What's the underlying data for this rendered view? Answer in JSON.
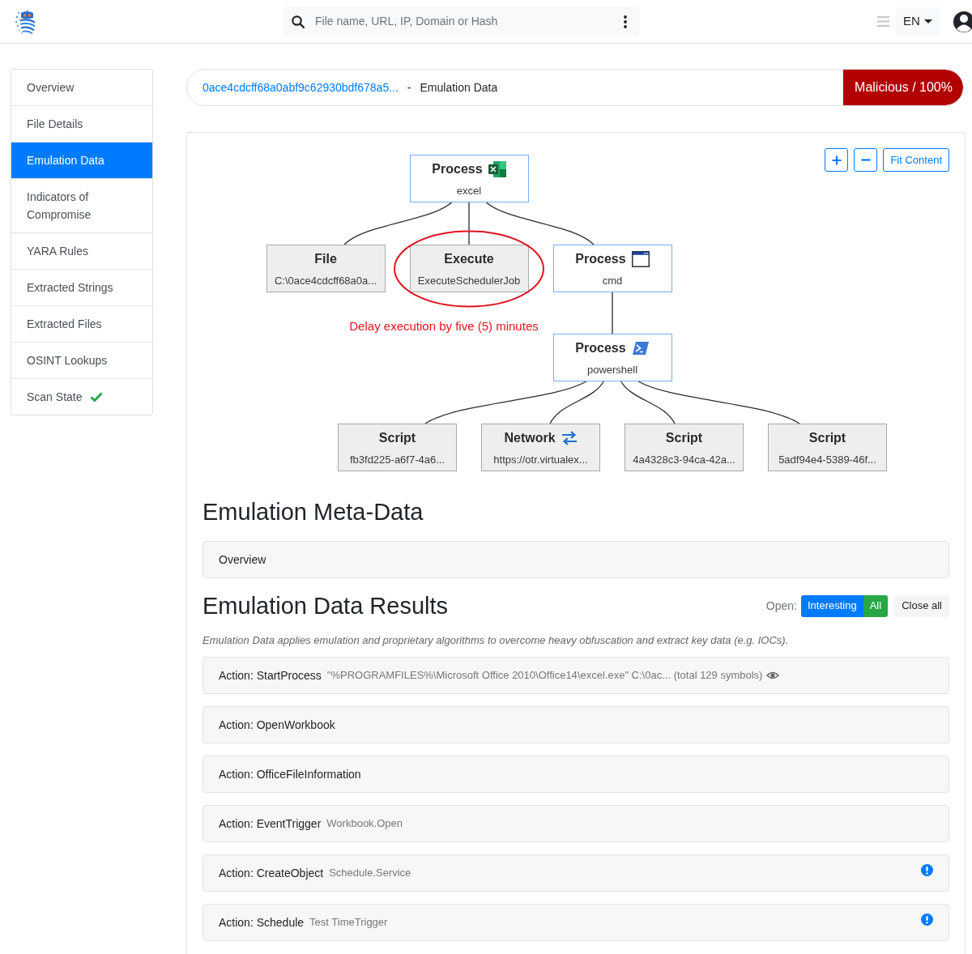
{
  "header": {
    "search": {
      "placeholder": "File name, URL, IP, Domain or Hash"
    },
    "language": "EN"
  },
  "sidebar": {
    "items": [
      {
        "label": "Overview",
        "selected": false,
        "kind": "link"
      },
      {
        "label": "File Details",
        "selected": false,
        "kind": "link"
      },
      {
        "label": "Emulation Data",
        "selected": true,
        "kind": "link"
      },
      {
        "label": "Indicators of Compromise",
        "selected": false,
        "kind": "link"
      },
      {
        "label": "YARA Rules",
        "selected": false,
        "kind": "link"
      },
      {
        "label": "Extracted Strings",
        "selected": false,
        "kind": "link"
      },
      {
        "label": "Extracted Files",
        "selected": false,
        "kind": "link"
      },
      {
        "label": "OSINT Lookups",
        "selected": false,
        "kind": "link"
      },
      {
        "label": "Scan State",
        "selected": false,
        "kind": "status",
        "complete": true
      }
    ]
  },
  "breadcrumb": {
    "link": "0ace4cdcff68a0abf9c62930bdf678a5...",
    "separator": "-",
    "current": "Emulation Data"
  },
  "verdict": {
    "text": "Malicious / 100%",
    "kind": "malicious"
  },
  "graph": {
    "controls": [
      {
        "kind": "zoom_in"
      },
      {
        "kind": "zoom_out"
      },
      {
        "kind": "fit",
        "label": "Fit Content"
      }
    ],
    "root": {
      "type": "Process",
      "name": "excel",
      "kind": "office",
      "highlighted": false,
      "children": [
        {
          "type": "File",
          "name": "C:\\0ace4cdcff68a0a...",
          "kind": "file",
          "highlighted": false
        },
        {
          "type": "Execute",
          "name": "ExecuteSchedulerJob",
          "kind": "execute",
          "highlighted": true,
          "annotation": "Delay execution by five (5) minutes"
        },
        {
          "type": "Process",
          "name": "cmd",
          "kind": "console",
          "highlighted": false,
          "children": [
            {
              "type": "Process",
              "name": "powershell",
              "kind": "shell",
              "highlighted": false,
              "children": [
                {
                  "type": "Script",
                  "name": "fb3fd225-a6f7-4a6...",
                  "kind": "script",
                  "highlighted": false
                },
                {
                  "type": "Network",
                  "name": "https://otr.virtualex...",
                  "kind": "network",
                  "highlighted": false
                },
                {
                  "type": "Script",
                  "name": "4a4328c3-94ca-42a...",
                  "kind": "script",
                  "highlighted": false
                },
                {
                  "type": "Script",
                  "name": "5adf94e4-5389-46f...",
                  "kind": "script",
                  "highlighted": false
                }
              ]
            }
          ]
        }
      ]
    }
  },
  "meta": {
    "title": "Emulation Meta-Data",
    "sections": [
      {
        "label": "Overview"
      }
    ]
  },
  "results": {
    "title": "Emulation Data Results",
    "filter_label": "Open:",
    "filters": [
      {
        "label": "Interesting",
        "color": "#007bff"
      },
      {
        "label": "All",
        "color": "#28a745"
      }
    ],
    "close_all": "Close all",
    "description": "Emulation Data applies emulation and proprietary algorithms to overcome heavy obfuscation and extract key data (e.g. IOCs).",
    "rows": [
      {
        "action": "Action: StartProcess",
        "detail": "\"%PROGRAMFILES%\\Microsoft Office 2010\\Office14\\excel.exe\" C:\\0ac... (total 129 symbols)",
        "preview": true,
        "flagged": false
      },
      {
        "action": "Action: OpenWorkbook",
        "preview": false,
        "flagged": false
      },
      {
        "action": "Action: OfficeFileInformation",
        "preview": false,
        "flagged": false
      },
      {
        "action": "Action: EventTrigger",
        "detail": "Workbook.Open",
        "preview": false,
        "flagged": false
      },
      {
        "action": "Action: CreateObject",
        "detail": "Schedule.Service",
        "preview": false,
        "flagged": true
      },
      {
        "action": "Action: Schedule",
        "detail": "Test TimeTrigger",
        "preview": false,
        "flagged": true
      }
    ]
  }
}
